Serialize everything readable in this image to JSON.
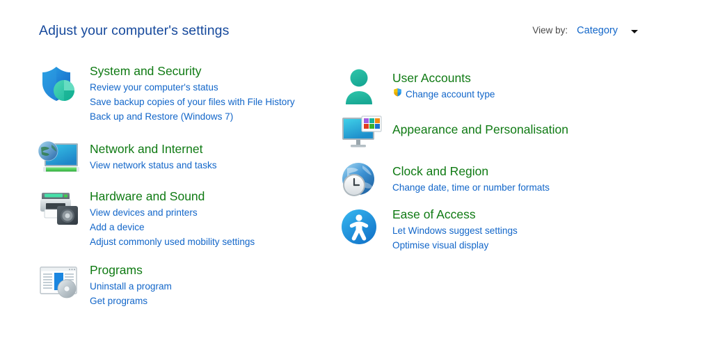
{
  "header": {
    "title": "Adjust your computer's settings",
    "view_by_label": "View by:",
    "view_by_value": "Category",
    "caret_icon": "chevron-down-icon"
  },
  "colors": {
    "background": "#ffffff",
    "page_title": "#16499c",
    "category_title": "#0f7a13",
    "link": "#1266c9",
    "view_by_label": "#4a4a4a"
  },
  "categories": {
    "left": [
      {
        "id": "system",
        "icon": "shield-security-icon",
        "title": "System and Security",
        "links": [
          "Review your computer's status",
          "Save backup copies of your files with File History",
          "Back up and Restore (Windows 7)"
        ]
      },
      {
        "id": "network",
        "icon": "network-globe-monitor-icon",
        "title": "Network and Internet",
        "links": [
          "View network status and tasks"
        ]
      },
      {
        "id": "hardware",
        "icon": "printer-speaker-icon",
        "title": "Hardware and Sound",
        "links": [
          "View devices and printers",
          "Add a device",
          "Adjust commonly used mobility settings"
        ]
      },
      {
        "id": "programs",
        "icon": "program-window-disc-icon",
        "title": "Programs",
        "links": [
          "Uninstall a program",
          "Get programs"
        ]
      }
    ],
    "right": [
      {
        "id": "useraccounts",
        "icon": "user-person-icon",
        "title": "User Accounts",
        "links": [
          "Change account type"
        ],
        "link_badges": [
          "uac-shield-icon"
        ]
      },
      {
        "id": "appearance",
        "icon": "monitor-palette-icon",
        "title": "Appearance and Personalisation",
        "links": []
      },
      {
        "id": "clock",
        "icon": "globe-clock-icon",
        "title": "Clock and Region",
        "links": [
          "Change date, time or number formats"
        ]
      },
      {
        "id": "easeofaccess",
        "icon": "accessibility-person-icon",
        "title": "Ease of Access",
        "links": [
          "Let Windows suggest settings",
          "Optimise visual display"
        ]
      }
    ]
  }
}
